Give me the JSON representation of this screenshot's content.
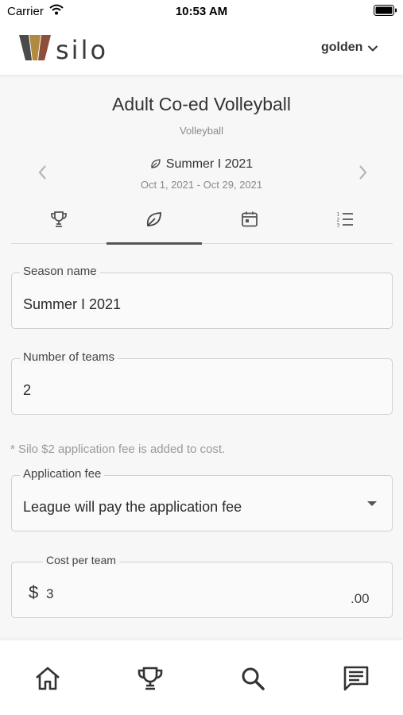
{
  "status_bar": {
    "carrier": "Carrier",
    "time": "10:53 AM"
  },
  "header": {
    "logo_text": "silo",
    "user_name": "golden",
    "logo_colors": [
      "#4b4b4b",
      "#b08a3e",
      "#8f4f3a"
    ]
  },
  "league": {
    "title": "Adult Co-ed Volleyball",
    "sport": "Volleyball"
  },
  "season": {
    "name": "Summer I 2021",
    "dates": "Oct 1, 2021 - Oct 29, 2021"
  },
  "tabs": [
    {
      "icon": "trophy-icon",
      "active": false
    },
    {
      "icon": "leaf-icon",
      "active": true
    },
    {
      "icon": "calendar-icon",
      "active": false
    },
    {
      "icon": "list-icon",
      "active": false
    }
  ],
  "form": {
    "season_name_label": "Season name",
    "season_name_value": "Summer I 2021",
    "teams_label": "Number of teams",
    "teams_value": "2",
    "fee_note": "* Silo $2 application fee is added to cost.",
    "fee_label": "Application fee",
    "fee_value": "League will pay the application fee",
    "cost_label": "Cost per team",
    "currency": "$",
    "cost_value": "3",
    "cost_cents": ".00"
  },
  "bottom_nav": [
    "home-icon",
    "trophy-icon",
    "search-icon",
    "chat-icon"
  ]
}
